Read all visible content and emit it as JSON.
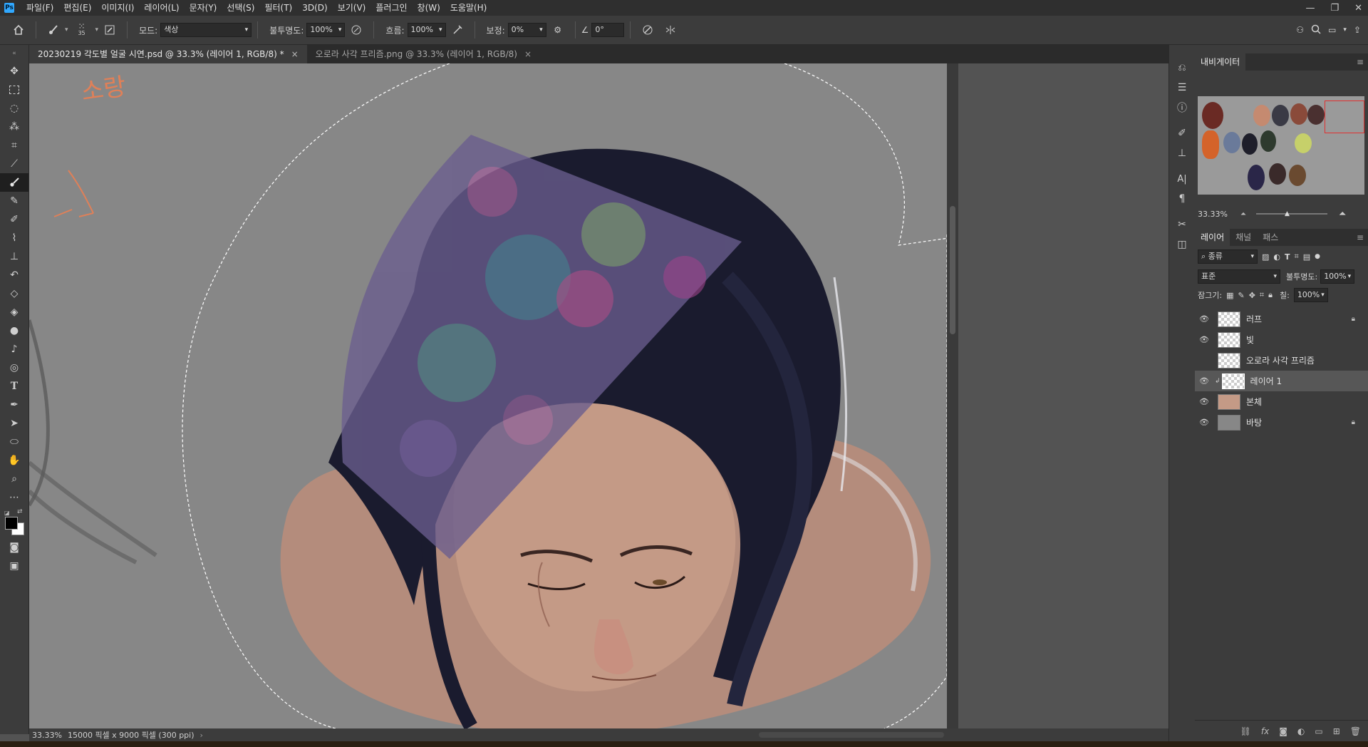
{
  "app": {
    "logo": "Ps"
  },
  "menu": [
    "파일(F)",
    "편집(E)",
    "이미지(I)",
    "레이어(L)",
    "문자(Y)",
    "선택(S)",
    "필터(T)",
    "3D(D)",
    "보기(V)",
    "플러그인",
    "창(W)",
    "도움말(H)"
  ],
  "options": {
    "brush_size": "35",
    "mode_label": "모드:",
    "mode_value": "색상",
    "opacity_label": "불투명도:",
    "opacity_value": "100%",
    "flow_label": "흐름:",
    "flow_value": "100%",
    "smoothing_label": "보정:",
    "smoothing_value": "0%",
    "angle_value": "0°"
  },
  "tabs": [
    {
      "label": "20230219 각도별 얼굴 시연.psd @ 33.3% (레이어 1, RGB/8) *",
      "active": true
    },
    {
      "label": "오로라 사각 프리즘.png @ 33.3% (레이어 1, RGB/8)",
      "active": false
    }
  ],
  "status": {
    "zoom": "33.33%",
    "doc_info": "15000 픽셀 x 9000 픽셀 (300 ppi)"
  },
  "navigator": {
    "title": "내비게이터",
    "zoom": "33.33%"
  },
  "layers_panel": {
    "tabs": [
      "레이어",
      "채널",
      "패스"
    ],
    "filter_label": "종류",
    "blend_mode": "표준",
    "opacity_label": "불투명도:",
    "opacity_value": "100%",
    "lock_label": "잠그기:",
    "fill_label": "칠:",
    "fill_value": "100%",
    "layers": [
      {
        "name": "러프",
        "visible": true,
        "locked": true,
        "selected": false
      },
      {
        "name": "빛",
        "visible": true,
        "locked": false,
        "selected": false
      },
      {
        "name": "오로라 사각 프리즘",
        "visible": false,
        "locked": false,
        "selected": false
      },
      {
        "name": "레이어 1",
        "visible": true,
        "locked": false,
        "selected": true
      },
      {
        "name": "본체",
        "visible": true,
        "locked": false,
        "selected": false
      },
      {
        "name": "바탕",
        "visible": true,
        "locked": true,
        "selected": false
      }
    ]
  },
  "canvas_text": "소랑",
  "colors": {
    "accent": "#31a8ff",
    "canvas_bg": "#878787",
    "skin": "#c49a86",
    "hair": "#1a1b2e"
  }
}
